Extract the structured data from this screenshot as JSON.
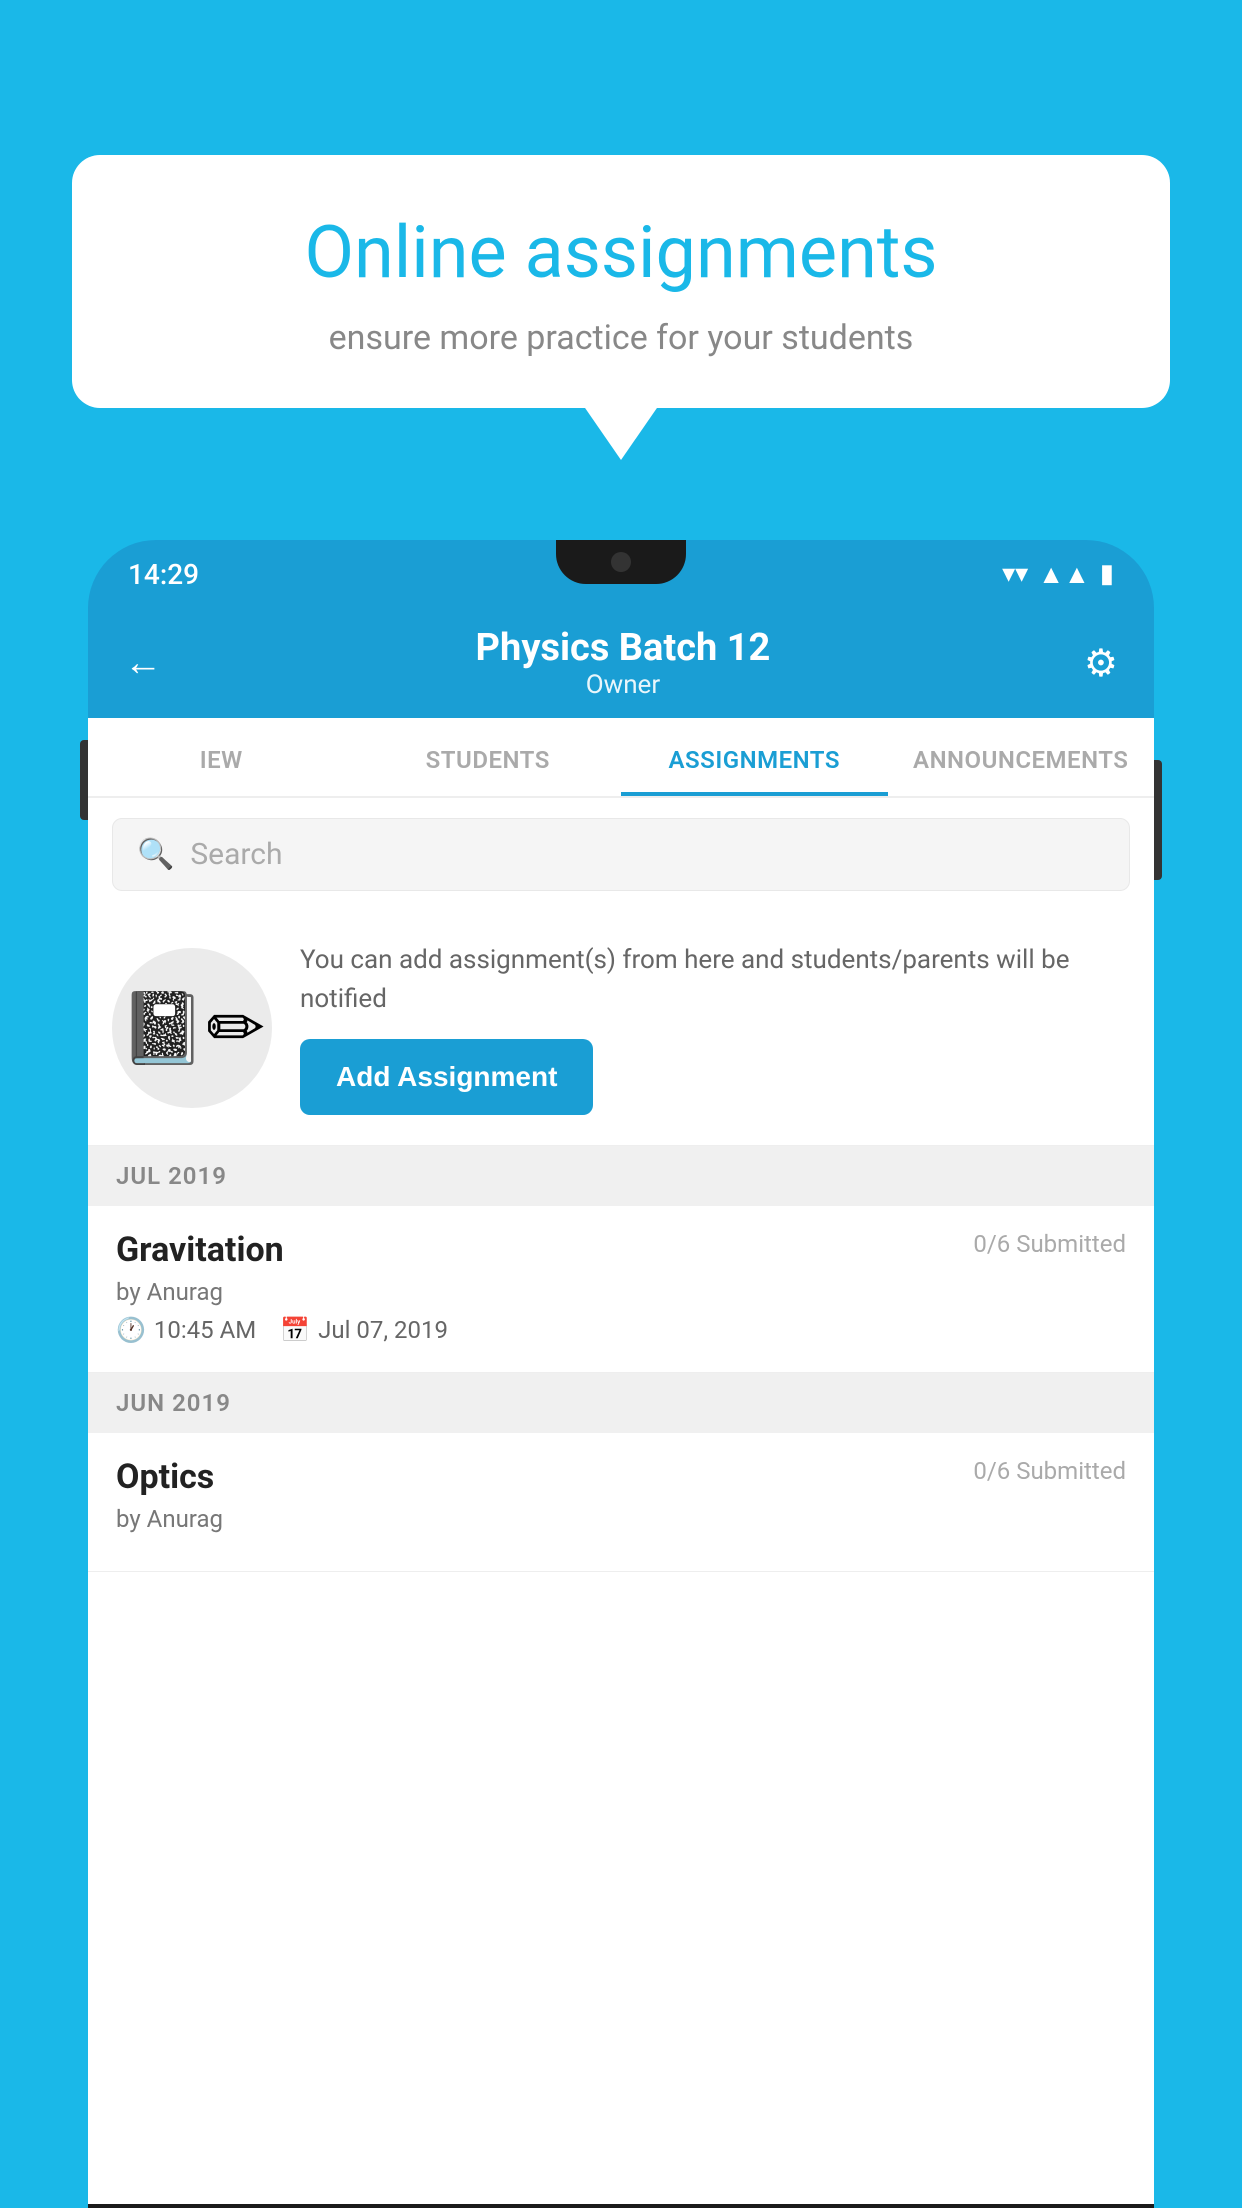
{
  "background_color": "#1ab8e8",
  "speech_bubble": {
    "title": "Online assignments",
    "subtitle": "ensure more practice for your students"
  },
  "phone": {
    "status_bar": {
      "time": "14:29",
      "icons": [
        "wifi",
        "signal",
        "battery"
      ]
    },
    "header": {
      "title": "Physics Batch 12",
      "subtitle": "Owner",
      "back_label": "←",
      "gear_label": "⚙"
    },
    "tabs": [
      {
        "label": "IEW",
        "active": false
      },
      {
        "label": "STUDENTS",
        "active": false
      },
      {
        "label": "ASSIGNMENTS",
        "active": true
      },
      {
        "label": "ANNOUNCEMENTS",
        "active": false
      }
    ],
    "search": {
      "placeholder": "Search"
    },
    "promo": {
      "description": "You can add assignment(s) from here and students/parents will be notified",
      "button_label": "Add Assignment"
    },
    "sections": [
      {
        "month": "JUL 2019",
        "assignments": [
          {
            "name": "Gravitation",
            "submitted": "0/6 Submitted",
            "by": "by Anurag",
            "time": "10:45 AM",
            "date": "Jul 07, 2019"
          }
        ]
      },
      {
        "month": "JUN 2019",
        "assignments": [
          {
            "name": "Optics",
            "submitted": "0/6 Submitted",
            "by": "by Anurag",
            "time": "",
            "date": ""
          }
        ]
      }
    ]
  }
}
